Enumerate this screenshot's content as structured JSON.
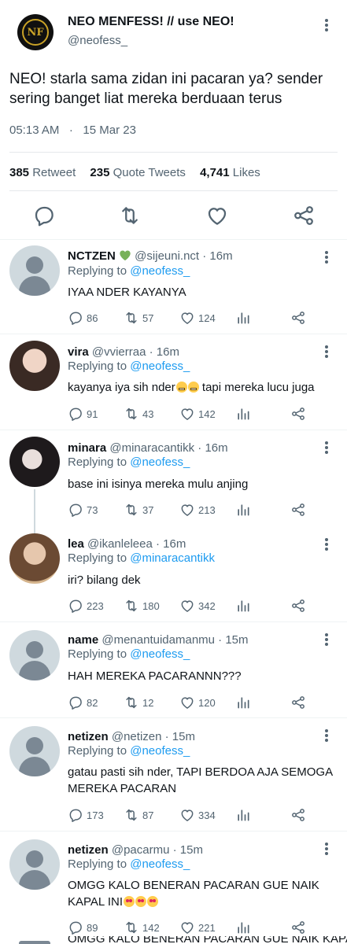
{
  "main": {
    "name": "NEO MENFESS! // use NEO!",
    "handle": "@neofess_",
    "text": "NEO! starla sama zidan ini pacaran ya? sender sering banget liat mereka berduaan terus",
    "time": "05:13 AM",
    "dot": "·",
    "date": "15 Mar 23",
    "retweets": "385",
    "retweets_label": "Retweet",
    "quotes": "235",
    "quotes_label": "Quote Tweets",
    "likes": "4,741",
    "likes_label": "Likes",
    "actions": [
      "reply-icon",
      "retweet-icon",
      "like-icon",
      "share-icon"
    ]
  },
  "replying_label": "Replying to",
  "replies": [
    {
      "name": "NCTZEN",
      "handle": "@sijeuni.nct · 16m",
      "to": "@neofess_",
      "text": "IYAA NDER KAYANYA",
      "replies": "86",
      "retweets": "57",
      "likes": "124",
      "badge": "green-heart"
    },
    {
      "name": "vira",
      "handle": "@vvierraa · 16m",
      "to": "@neofess_",
      "text": "kayanya iya sih nder",
      "text_after": " tapi mereka lucu juga",
      "replies": "91",
      "retweets": "43",
      "likes": "142"
    },
    {
      "name": "minara",
      "handle": "@minaracantikk · 16m",
      "to": "@neofess_",
      "text": "base ini isinya mereka mulu anjing",
      "replies": "73",
      "retweets": "37",
      "likes": "213"
    },
    {
      "name": "lea",
      "handle": "@ikanleleea · 16m",
      "to": "@minaracantikk",
      "text": "iri? bilang dek",
      "replies": "223",
      "retweets": "180",
      "likes": "342"
    },
    {
      "name": "name",
      "handle": "@menantuidamanmu · 15m",
      "to": "@neofess_",
      "text": "HAH MEREKA PACARANNN???",
      "replies": "82",
      "retweets": "12",
      "likes": "120"
    },
    {
      "name": "netizen",
      "handle": "@netizen · 15m",
      "to": "@neofess_",
      "text": "gatau pasti sih nder, TAPI BERDOA AJA SEMOGA MEREKA PACARAN",
      "replies": "173",
      "retweets": "87",
      "likes": "334"
    },
    {
      "name": "netizen",
      "handle": "@pacarmu · 15m",
      "to": "@neofess_",
      "text": "OMGG KALO BENERAN PACARAN GUE NAIK KAPAL INI",
      "replies": "89",
      "retweets": "142",
      "likes": "221"
    }
  ],
  "peek_text": "OMGG KALO BENERAN PACARAN GUE NAIK KAPAL"
}
